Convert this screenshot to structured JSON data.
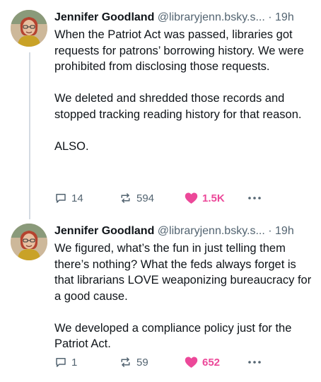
{
  "posts": [
    {
      "author": {
        "display_name": "Jennifer Goodland",
        "handle": "@libraryjenn.bsky.s...",
        "separator": "·",
        "time": "19h"
      },
      "paragraphs": [
        "When the Patriot Act was passed, libraries got requests for patrons’ borrowing history. We were prohibited from disclosing those requests.",
        "We deleted and shredded those records and stopped tracking reading history for that reason.",
        "ALSO."
      ],
      "stats": {
        "replies": "14",
        "reposts": "594",
        "likes": "1.5K",
        "liked": true
      }
    },
    {
      "author": {
        "display_name": "Jennifer Goodland",
        "handle": "@libraryjenn.bsky.s...",
        "separator": "·",
        "time": "19h"
      },
      "paragraphs": [
        "We figured, what’s the fun in just telling them there’s nothing? What the feds always forget is that librarians LOVE weaponizing bureaucracy for a good cause.",
        "We developed a compliance policy just for the Patriot Act."
      ],
      "stats": {
        "replies": "1",
        "reposts": "59",
        "likes": "652",
        "liked": true
      }
    }
  ],
  "colors": {
    "text": "#0f1419",
    "muted": "#536471",
    "like": "#ec4899",
    "thread_line": "#d4dbe2"
  },
  "icons": {
    "reply": "speech-bubble-icon",
    "repost": "repost-arrows-icon",
    "like": "heart-icon",
    "more": "ellipsis-icon"
  }
}
